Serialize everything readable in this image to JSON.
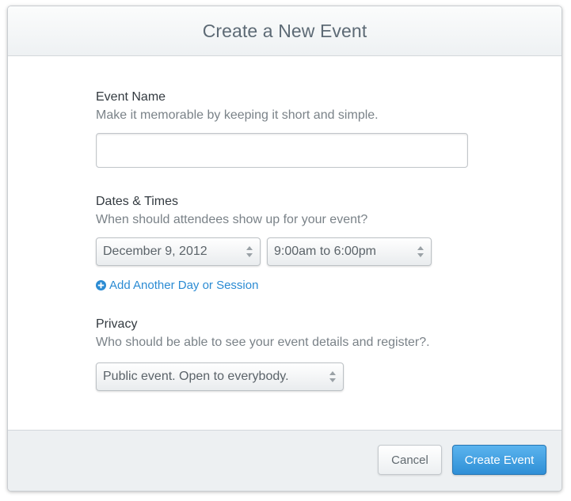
{
  "modal": {
    "title": "Create a New Event"
  },
  "event_name": {
    "label": "Event Name",
    "help": "Make it memorable by keeping it short and simple.",
    "value": "",
    "placeholder": ""
  },
  "dates": {
    "label": "Dates & Times",
    "help": "When should attendees show up for your event?",
    "date_value": "December 9, 2012",
    "time_value": "9:00am to 6:00pm",
    "add_link": "Add Another Day or Session"
  },
  "privacy": {
    "label": "Privacy",
    "help": "Who should be able to see your event details and register?.",
    "value": "Public event. Open to everybody."
  },
  "footer": {
    "cancel_label": "Cancel",
    "create_label": "Create Event"
  },
  "colors": {
    "link": "#2b8bd3",
    "primary_button": "#3a99dd",
    "title": "#5d6a75"
  },
  "icons": {
    "select_arrows": "up-down-arrows-icon",
    "add": "plus-circle-icon"
  }
}
